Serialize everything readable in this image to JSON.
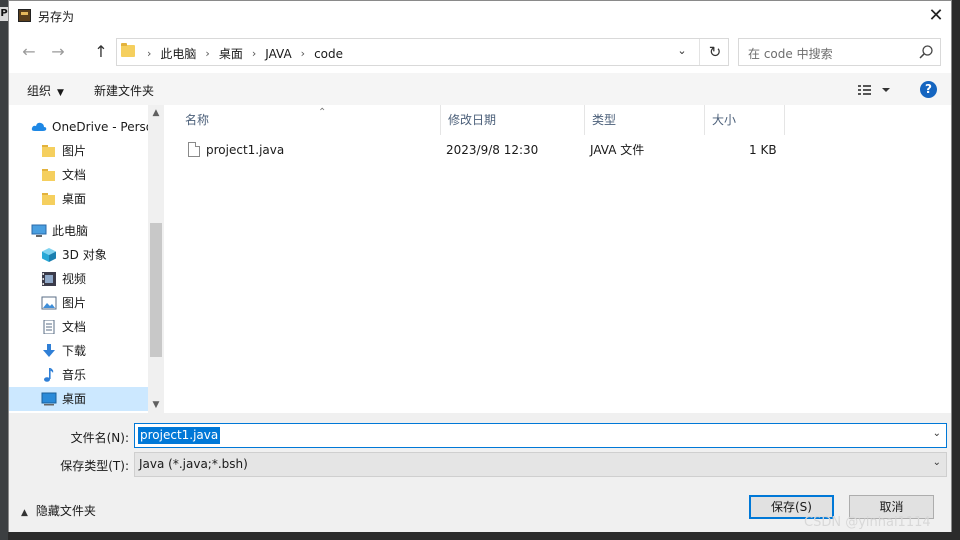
{
  "dialog": {
    "title": "另存为",
    "close_glyph": "✕"
  },
  "nav": {
    "back_glyph": "←",
    "forward_glyph": "→",
    "up_glyph": "↑",
    "breadcrumbs": [
      "此电脑",
      "桌面",
      "JAVA",
      "code"
    ],
    "separator": "›",
    "dropdown_glyph": "⌄",
    "refresh_glyph": "↻"
  },
  "search": {
    "placeholder": "在 code 中搜索"
  },
  "toolbar": {
    "organize_label": "组织",
    "new_folder_label": "新建文件夹",
    "help_label": "?"
  },
  "sidebar": {
    "items": [
      {
        "label": "OneDrive - Perso",
        "icon": "cloud-icon"
      },
      {
        "label": "图片",
        "icon": "folder-icon"
      },
      {
        "label": "文档",
        "icon": "folder-icon"
      },
      {
        "label": "桌面",
        "icon": "folder-icon"
      },
      {
        "label": "此电脑",
        "icon": "computer-icon"
      },
      {
        "label": "3D 对象",
        "icon": "cube-icon"
      },
      {
        "label": "视频",
        "icon": "video-icon"
      },
      {
        "label": "图片",
        "icon": "picture-icon"
      },
      {
        "label": "文档",
        "icon": "document-icon"
      },
      {
        "label": "下载",
        "icon": "download-icon"
      },
      {
        "label": "音乐",
        "icon": "music-icon"
      },
      {
        "label": "桌面",
        "icon": "desktop-icon",
        "selected": true
      }
    ]
  },
  "filelist": {
    "columns": [
      "名称",
      "修改日期",
      "类型",
      "大小"
    ],
    "rows": [
      {
        "name": "project1.java",
        "modified": "2023/9/8 12:30",
        "type": "JAVA 文件",
        "size": "1 KB"
      }
    ]
  },
  "form": {
    "filename_label": "文件名(N):",
    "filename_value": "project1.java",
    "filetype_label": "保存类型(T):",
    "filetype_value": "Java (*.java;*.bsh)",
    "hide_folders_label": "隐藏文件夹",
    "save_label": "保存(S)",
    "cancel_label": "取消"
  },
  "watermark": "CSDN @yinhai1114",
  "colors": {
    "accent": "#0078d7",
    "selection": "#cce8ff",
    "help": "#1565c0",
    "folder": "#f5cf5e"
  }
}
